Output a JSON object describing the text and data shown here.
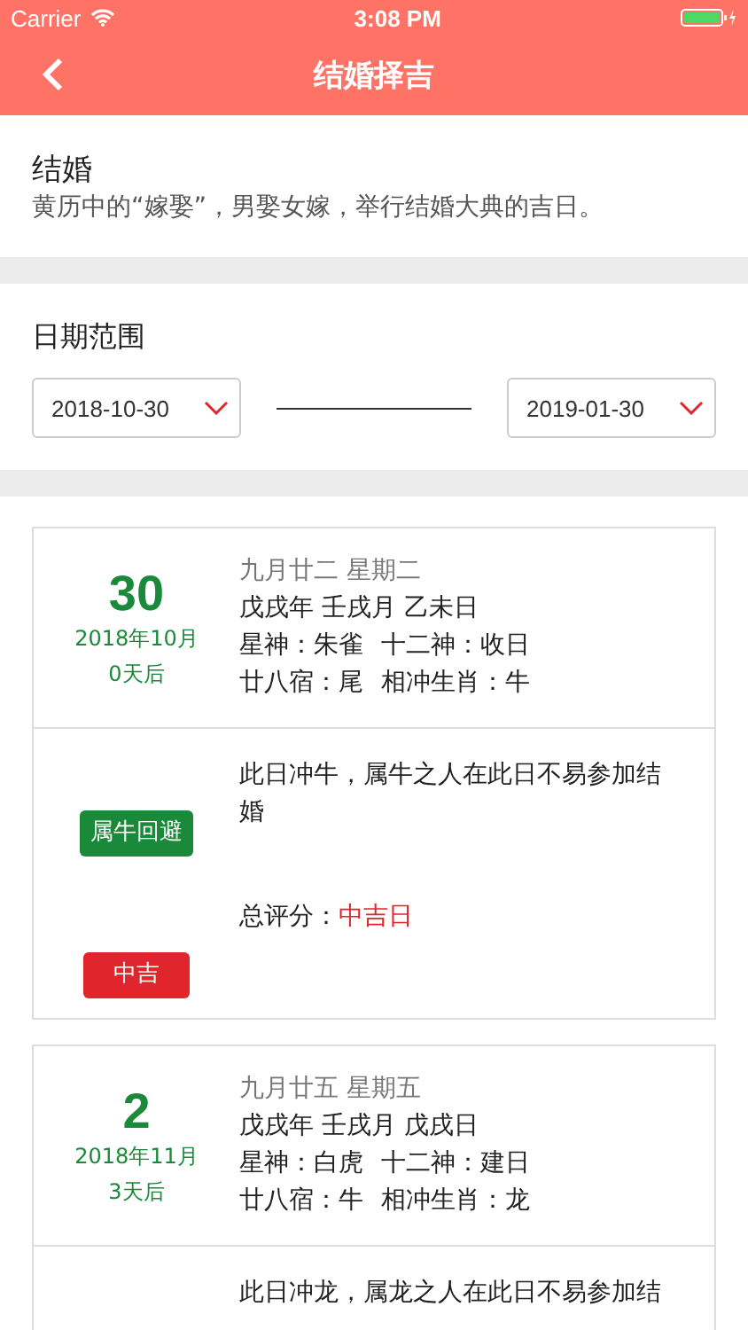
{
  "status_bar": {
    "carrier": "Carrier",
    "time": "3:08 PM"
  },
  "nav": {
    "title": "结婚择吉"
  },
  "intro": {
    "title": "结婚",
    "description": "黄历中的“嫁娶”，男娶女嫁，举行结婚大典的吉日。"
  },
  "date_range": {
    "label": "日期范围",
    "start": "2018-10-30",
    "end": "2019-01-30"
  },
  "days": [
    {
      "day": "30",
      "month_year": "2018年10月",
      "countdown": "0天后",
      "lunar_date": "九月廿二 星期二",
      "ganzhi": "戊戌年 壬戌月 乙未日",
      "star_god": "星神：朱雀",
      "twelve_god": "十二神：收日",
      "mansion": "廿八宿：尾",
      "clash": "相冲生肖：牛",
      "avoid_tag": "属牛回避",
      "note": "此日冲牛，属牛之人在此日不易参加结婚",
      "rating_label": "总评分：",
      "rating_value": "中吉日",
      "rating_tag": "中吉"
    },
    {
      "day": "2",
      "month_year": "2018年11月",
      "countdown": "3天后",
      "lunar_date": "九月廿五 星期五",
      "ganzhi": "戊戌年 壬戌月 戊戌日",
      "star_god": "星神：白虎",
      "twelve_god": "十二神：建日",
      "mansion": "廿八宿：牛",
      "clash": "相冲生肖：龙",
      "note": "此日冲龙，属龙之人在此日不易参加结"
    }
  ]
}
